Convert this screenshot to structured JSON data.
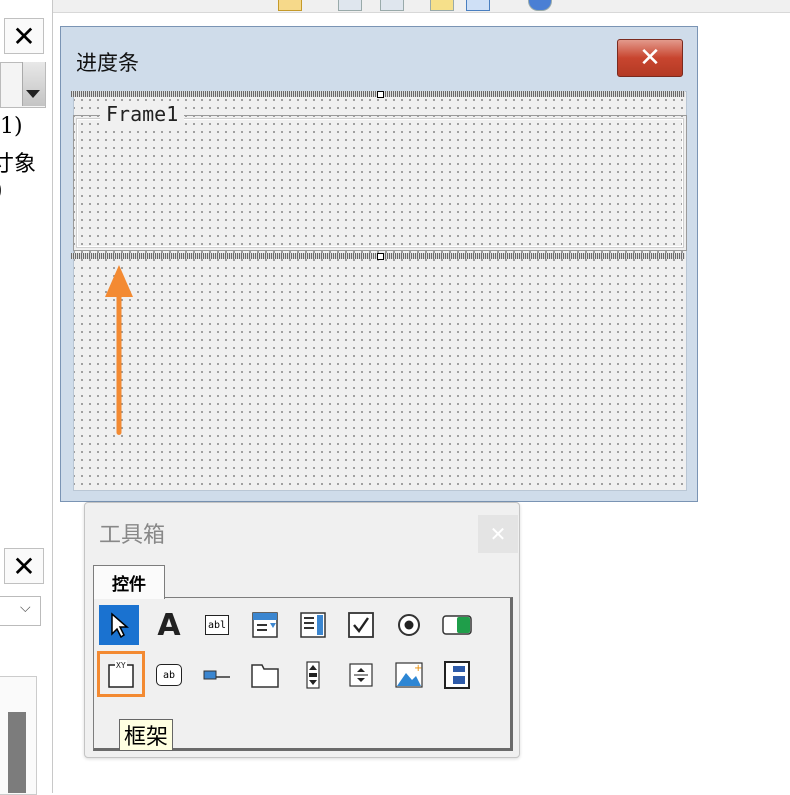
{
  "left_panel": {
    "close_glyph": "✕",
    "fragments": [
      "1)",
      "寸象",
      ")"
    ]
  },
  "form": {
    "title": "进度条",
    "close_glyph": "✕",
    "frame_caption": "Frame1"
  },
  "toolbox": {
    "title": "工具箱",
    "close_glyph": "✕",
    "tab_label": "控件",
    "tooltip": "框架",
    "tools_row1": [
      {
        "name": "select-objects-icon",
        "glyph": "▶"
      },
      {
        "name": "label-icon",
        "glyph": "A"
      },
      {
        "name": "textbox-icon",
        "glyph": "abl"
      },
      {
        "name": "combobox-icon",
        "glyph": "☰"
      },
      {
        "name": "listbox-icon",
        "glyph": "☰"
      },
      {
        "name": "checkbox-icon",
        "glyph": "✓"
      },
      {
        "name": "option-button-icon",
        "glyph": "◉"
      },
      {
        "name": "toggle-button-icon",
        "glyph": "▮"
      }
    ],
    "tools_row2": [
      {
        "name": "frame-icon",
        "glyph": "XY"
      },
      {
        "name": "command-button-icon",
        "glyph": "ab"
      },
      {
        "name": "tabstrip-icon",
        "glyph": "▭"
      },
      {
        "name": "multipage-icon",
        "glyph": "▭"
      },
      {
        "name": "scrollbar-icon",
        "glyph": "⬍"
      },
      {
        "name": "spinbutton-icon",
        "glyph": "÷"
      },
      {
        "name": "image-icon",
        "glyph": "▲"
      },
      {
        "name": "refedit-icon",
        "glyph": "▣"
      }
    ]
  },
  "colors": {
    "selected_tool": "#1a72d0",
    "highlight": "#f38a32",
    "arrow": "#f38a32",
    "form_title_bar": "#cfdcea",
    "close_button": "#c8452f"
  }
}
